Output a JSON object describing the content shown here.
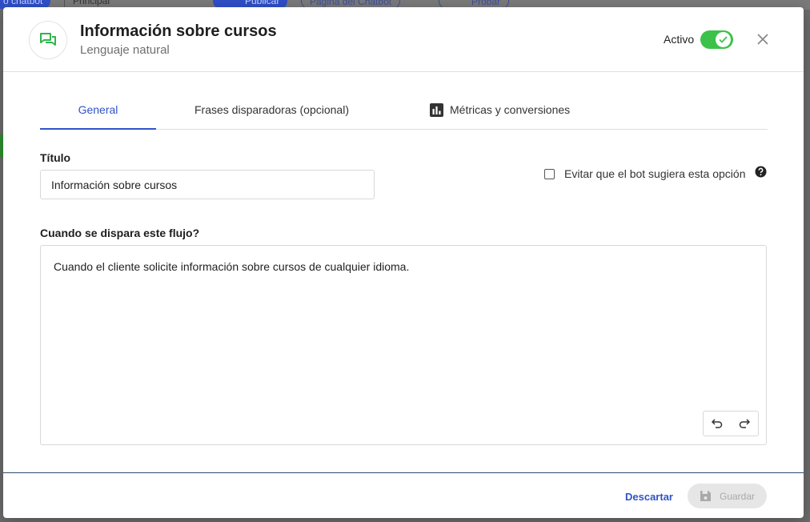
{
  "background": {
    "chatbot_pill": "o chatbot",
    "principal_select": "Principal",
    "publish_button": "Publicar",
    "chatbot_page_link": "Página del Chatbot",
    "try_button": "Probar"
  },
  "header": {
    "title": "Información sobre cursos",
    "subtitle": "Lenguaje natural",
    "active_label": "Activo",
    "active": true,
    "icon": "chat-bubbles-icon"
  },
  "tabs": [
    {
      "label": "General",
      "active": true
    },
    {
      "label": "Frases disparadoras (opcional)",
      "active": false
    },
    {
      "label": "Métricas y conversiones",
      "active": false,
      "icon": "bar-chart-icon"
    }
  ],
  "form": {
    "title_label": "Título",
    "title_value": "Información sobre cursos",
    "avoid_suggest_label": "Evitar que el bot sugiera esta opción",
    "avoid_suggest_checked": false,
    "trigger_label": "Cuando se dispara este flujo?",
    "trigger_value": "Cuando el cliente solicite información sobre cursos de cualquier idioma."
  },
  "footer": {
    "discard_label": "Descartar",
    "save_label": "Guardar",
    "save_enabled": false
  },
  "colors": {
    "accent": "#2f54c8",
    "toggle_on": "#3cc24a",
    "icon_green": "#2fb54a"
  }
}
